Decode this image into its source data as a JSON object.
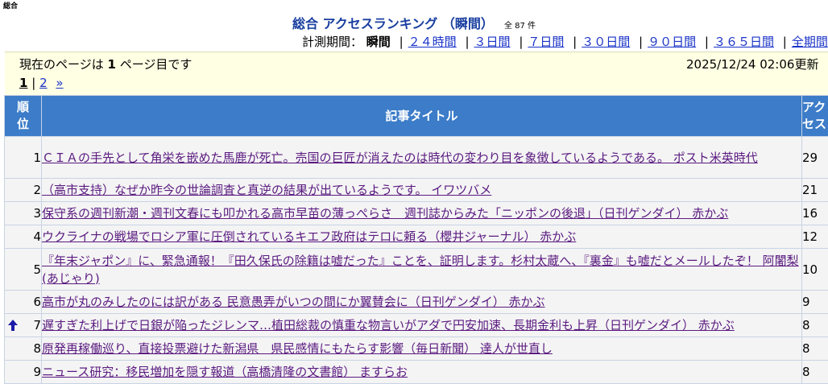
{
  "corner_label": "総合",
  "heading": {
    "title": "総合 アクセスランキング （瞬間）",
    "count": "全 87 件"
  },
  "period": {
    "label": "計測期間：",
    "current": "瞬間",
    "links": [
      "２４時間",
      "３日間",
      "７日間",
      "３０日間",
      "９０日間",
      "３６５日間",
      "全期間"
    ]
  },
  "info": {
    "page_prefix": "現在のページは",
    "page_number": "1",
    "page_suffix": "ページ目です",
    "updated": "2025/12/24 02:06更新"
  },
  "pager": {
    "current": "1",
    "sep": "|",
    "next_page": "2",
    "next_arrow": "»"
  },
  "table": {
    "headers": {
      "rank_line1": "順",
      "rank_line2": "位",
      "title": "記事タイトル",
      "access_line1": "アク",
      "access_line2": "セス"
    },
    "rows": [
      {
        "rank": "1",
        "title": "ＣＩＡの手先として角栄を嵌めた馬鹿が死亡。売国の巨匠が消えたのは時代の変わり目を象徴しているようである。 ポスト米英時代",
        "access": "29",
        "arrow": false
      },
      {
        "rank": "2",
        "title": "（高市支持）なぜか昨今の世論調査と真逆の結果が出ているようです。 イワツバメ",
        "access": "21",
        "arrow": false
      },
      {
        "rank": "3",
        "title": "保守系の週刊新潮・週刊文春にも叩かれる高市早苗の薄っぺらさ　週刊誌からみた「ニッポンの後退」（日刊ゲンダイ） 赤かぶ",
        "access": "16",
        "arrow": false
      },
      {
        "rank": "4",
        "title": "ウクライナの戦場でロシア軍に圧倒されているキエフ政府はテロに頼る（櫻井ジャーナル） 赤かぶ",
        "access": "12",
        "arrow": false
      },
      {
        "rank": "5",
        "title": "『年末ジャポン』に、緊急通報！『田久保氏の除籍は嘘だった』ことを、証明します。杉村太蔵へ、『裏金』も嘘だとメールしたぞ！ 阿闍梨(あじゃり)",
        "access": "10",
        "arrow": false
      },
      {
        "rank": "6",
        "title": "高市が丸のみしたのには訳がある 民意愚弄がいつの間にか翼賛会に（日刊ゲンダイ） 赤かぶ",
        "access": "9",
        "arrow": false
      },
      {
        "rank": "7",
        "title": "遅すぎた利上げで日銀が陥ったジレンマ…植田総裁の慎重な物言いがアダで円安加速、長期金利も上昇（日刊ゲンダイ） 赤かぶ",
        "access": "8",
        "arrow": true
      },
      {
        "rank": "8",
        "title": "原発再稼働巡り、直接投票避けた新潟県　県民感情にもたらす影響（毎日新聞） 達人が世直し",
        "access": "8",
        "arrow": false
      },
      {
        "rank": "9",
        "title": "ニュース研究：移民増加を隠す報道（高橋清隆の文書館） ますらお",
        "access": "8",
        "arrow": false
      }
    ]
  },
  "colors": {
    "header_bg": "#3c7cc8",
    "info_bg": "#ffffe4",
    "title_link": "#5a1a80",
    "nav_link": "#1a33c8",
    "up_arrow": "#1a1aa8"
  },
  "icons": {
    "up_arrow": "up-arrow-icon"
  }
}
